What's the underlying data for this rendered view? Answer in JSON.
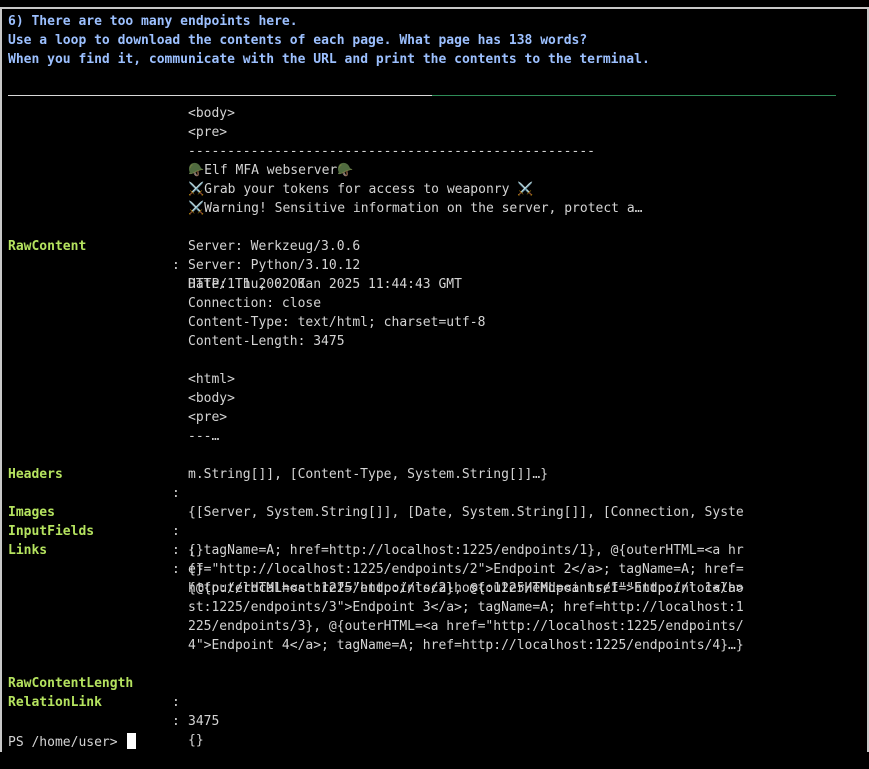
{
  "instructions": [
    "6) There are too many endpoints here.",
    "Use a loop to download the contents of each page. What page has 138 words?",
    "When you find it, communicate with the URL and print the contents to the terminal."
  ],
  "content_tail": [
    "<body>",
    "<pre>",
    "----------------------------------------------------",
    "🪖Elf MFA webserver🪖",
    "⚔️Grab your tokens for access to weaponry ⚔️",
    "⚔️Warning! Sensitive information on the server, protect a…"
  ],
  "fields": {
    "rawcontent": {
      "key": "RawContent",
      "lines": [
        "HTTP/1.1 200 OK",
        "Server: Werkzeug/3.0.6",
        "Server: Python/3.10.12",
        "Date: Thu, 02 Jan 2025 11:44:43 GMT",
        "Connection: close",
        "Content-Type: text/html; charset=utf-8",
        "Content-Length: 3475",
        "",
        "<html>",
        "<body>",
        "<pre>",
        "---…"
      ]
    },
    "headers": {
      "key": "Headers",
      "lines": [
        "{[Server, System.String[]], [Date, System.String[]], [Connection, Syste",
        "m.String[]], [Content-Type, System.String[]]…}"
      ]
    },
    "images": {
      "key": "Images",
      "value": "{}"
    },
    "inputfields": {
      "key": "InputFields",
      "value": "{}"
    },
    "links": {
      "key": "Links",
      "lines": [
        "{@{outerHTML=<a href=\"http://localhost:1225/endpoints/1\">Endpoint 1</a>",
        "; tagName=A; href=http://localhost:1225/endpoints/1}, @{outerHTML=<a hr",
        "ef=\"http://localhost:1225/endpoints/2\">Endpoint 2</a>; tagName=A; href=",
        "http://localhost:1225/endpoints/2}, @{outerHTML=<a href=\"http://localho",
        "st:1225/endpoints/3\">Endpoint 3</a>; tagName=A; href=http://localhost:1",
        "225/endpoints/3}, @{outerHTML=<a href=\"http://localhost:1225/endpoints/",
        "4\">Endpoint 4</a>; tagName=A; href=http://localhost:1225/endpoints/4}…}"
      ]
    },
    "rawcontentlength": {
      "key": "RawContentLength",
      "value": "3475"
    },
    "relationlink": {
      "key": "RelationLink",
      "value": "{}"
    }
  },
  "separator": ":",
  "prompt": "PS /home/user>",
  "colors": {
    "background": "#000000",
    "instruction_text": "#9cc0ff",
    "property_key": "#b5e35f",
    "body_text": "#d4d4d4",
    "divider_right": "#2e8b57"
  }
}
